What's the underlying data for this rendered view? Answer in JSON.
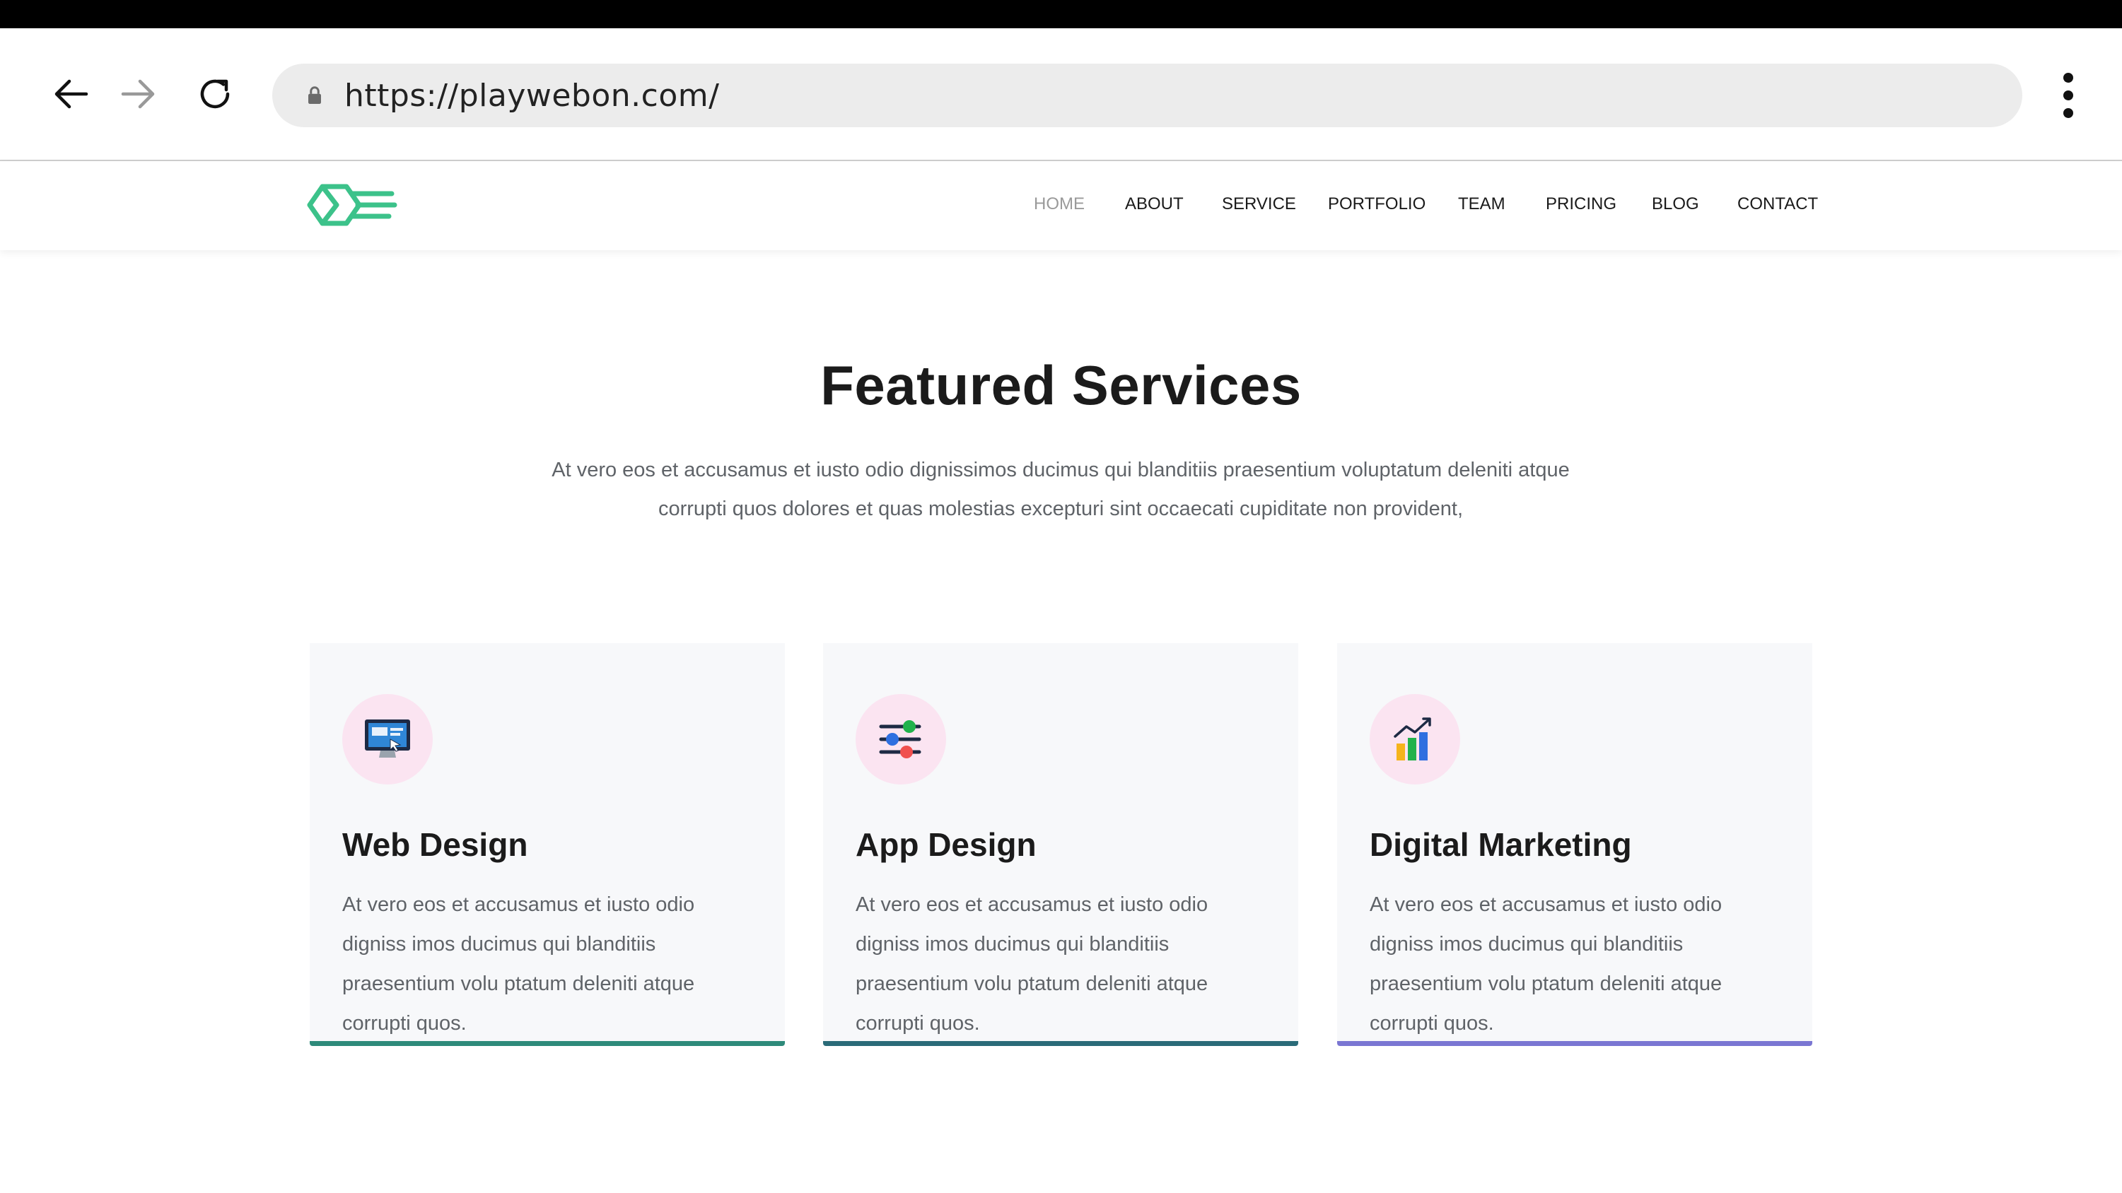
{
  "browser": {
    "url": "https://playwebon.com/"
  },
  "nav": {
    "items": [
      {
        "label": "HOME",
        "active": true
      },
      {
        "label": "ABOUT"
      },
      {
        "label": "SERVICE"
      },
      {
        "label": "PORTFOLIO"
      },
      {
        "label": "TEAM"
      },
      {
        "label": "PRICING"
      },
      {
        "label": "BLOG"
      },
      {
        "label": "CONTACT"
      }
    ]
  },
  "section": {
    "title": "Featured Services",
    "description": "At vero eos et accusamus et iusto odio dignissimos ducimus qui blanditiis praesentium voluptatum deleniti atque corrupti quos dolores et quas molestias excepturi sint occaecati cupiditate non provident,"
  },
  "cards": [
    {
      "title": "Web Design",
      "icon": "monitor-icon",
      "text": "At vero eos et accusamus et iusto odio digniss imos ducimus qui blanditiis praesentium volu ptatum deleniti atque corrupti quos.",
      "accent": "#2e8a7a"
    },
    {
      "title": "App Design",
      "icon": "sliders-icon",
      "text": "At vero eos et accusamus et iusto odio digniss imos ducimus qui blanditiis praesentium volu ptatum deleniti atque corrupti quos.",
      "accent": "#2a6b78"
    },
    {
      "title": "Digital Marketing",
      "icon": "bar-chart-icon",
      "text": "At vero eos et accusamus et iusto odio digniss imos ducimus qui blanditiis praesentium volu ptatum deleniti atque corrupti quos.",
      "accent": "#7a76d2"
    }
  ],
  "colors": {
    "brand_green": "#3cc28a",
    "icon_bg": "#fbe4f1"
  }
}
